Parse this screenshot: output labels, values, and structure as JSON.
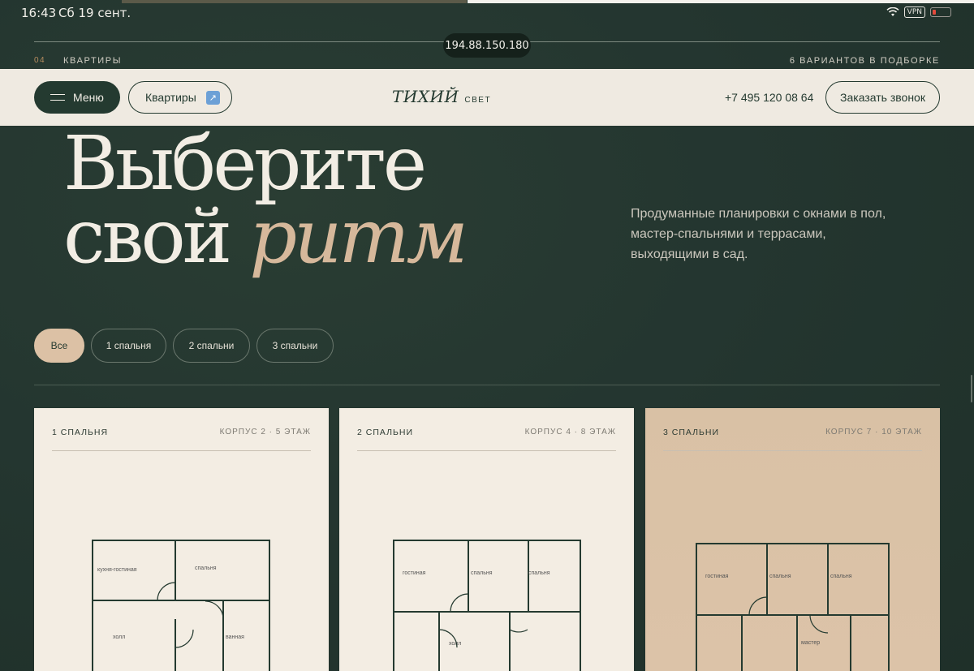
{
  "status": {
    "time": "16:43",
    "date": "Сб 19 сент.",
    "vpn": "VPN"
  },
  "browser": {
    "address": "194.88.150.180"
  },
  "section": {
    "number": "04",
    "name": "КВАРТИРЫ",
    "count": "6 ВАРИАНТОВ В ПОДБОРКЕ"
  },
  "nav": {
    "menu_label": "Меню",
    "apartments_label": "Квартиры",
    "logo_main": "ТИХИЙ",
    "logo_sub": "СВЕТ",
    "phone": "+7 495 120 08 64",
    "call_label": "Заказать звонок"
  },
  "hero": {
    "line1": "Выберите",
    "line2_plain": "свой ",
    "line2_accent": "ритм",
    "description": "Продуманные планировки с окнами в пол, мастер-спальнями и террасами, выходящими в сад."
  },
  "filters": [
    {
      "label": "Все",
      "active": true
    },
    {
      "label": "1 спальня",
      "active": false
    },
    {
      "label": "2 спальни",
      "active": false
    },
    {
      "label": "3 спальни",
      "active": false
    }
  ],
  "cards": [
    {
      "type": "1 СПАЛЬНЯ",
      "meta": "КОРПУС 2 · 5 ЭТАЖ",
      "rooms": [
        "кухня-гостиная",
        "спальня",
        "холл",
        "ванная"
      ]
    },
    {
      "type": "2 СПАЛЬНИ",
      "meta": "КОРПУС 4 · 8 ЭТАЖ",
      "rooms": [
        "гостиная",
        "спальня",
        "спальня",
        "холл"
      ]
    },
    {
      "type": "3 СПАЛЬНИ",
      "meta": "КОРПУС 7 · 10 ЭТАЖ",
      "rooms": [
        "гостиная",
        "спальня",
        "спальня",
        "мастер"
      ]
    }
  ],
  "colors": {
    "background": "#243630",
    "nav_bg": "#efeae1",
    "accent": "#d6b89b",
    "dark_button": "#243a30",
    "card_light": "#f3ede3",
    "card_warm": "#dcc3a8"
  }
}
